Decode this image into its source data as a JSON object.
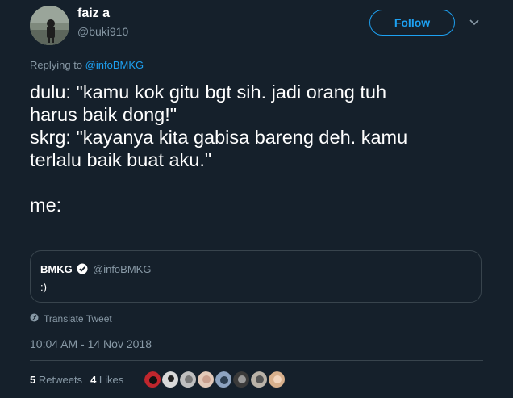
{
  "author": {
    "display_name": "faiz a",
    "handle": "@buki910"
  },
  "follow_label": "Follow",
  "reply": {
    "prefix": "Replying to ",
    "target": "@infoBMKG"
  },
  "tweet_lines": [
    "dulu: \"kamu kok gitu bgt sih. jadi orang tuh",
    "harus baik dong!\"",
    "skrg: \"kayanya kita gabisa bareng deh. kamu",
    "terlalu baik buat aku.\"",
    "",
    "me:"
  ],
  "quote": {
    "name": "BMKG",
    "handle": "@infoBMKG",
    "text": ":)"
  },
  "translate_label": "Translate Tweet",
  "timestamp": "10:04 AM - 14 Nov 2018",
  "stats": {
    "retweets_count": "5",
    "retweets_label": "Retweets",
    "likes_count": "4",
    "likes_label": "Likes"
  },
  "liker_avatars": [
    {
      "name": "liker-1",
      "color": "#c0262d"
    },
    {
      "name": "liker-2",
      "color": "#d9d9d9"
    },
    {
      "name": "liker-3",
      "color": "#bfbfbf"
    },
    {
      "name": "liker-4",
      "color": "#e3c9b8"
    },
    {
      "name": "liker-5",
      "color": "#8da3c0"
    },
    {
      "name": "liker-6",
      "color": "#3a3a3a"
    },
    {
      "name": "liker-7",
      "color": "#b9b2a8"
    },
    {
      "name": "liker-8",
      "color": "#d8b08c"
    }
  ],
  "colors": {
    "background": "#15202b",
    "accent": "#1da1f2",
    "secondary_text": "#8899a6",
    "border": "#38444d"
  }
}
